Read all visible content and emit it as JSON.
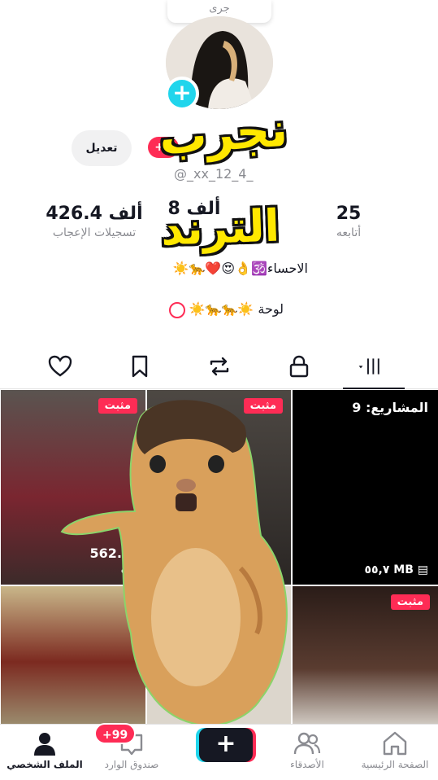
{
  "profile": {
    "display_name": "جرى",
    "handle": "@_xx_12_4_",
    "edit_label": "تعديل",
    "notif_count": "+9",
    "bio_line1": "الاحساء🕉️👌😍❤️🐆☀️",
    "bio_line2": "لوحة ☀️🐆🐆☀️"
  },
  "stats": {
    "likes_value": "426.4 ألف",
    "likes_label": "تسجيلات الإعجاب",
    "followers_value": "8 ألف",
    "following_value": "25",
    "following_label": "أتابعه"
  },
  "sticker": {
    "line1": "نجرب",
    "line2": "الترند"
  },
  "videos": {
    "pinned_label": "مثبت",
    "views_1": "562.6 ألف",
    "drafts_label": "المشاريع: 9",
    "drafts_size": "٥٥,٧ MB"
  },
  "nav": {
    "home": "الصفحة الرئيسية",
    "friends": "الأصدقاء",
    "inbox": "صندوق الوارد",
    "profile": "الملف الشخصي",
    "inbox_badge": "+99",
    "create": "+"
  },
  "colors": {
    "accent_red": "#fe2c55",
    "accent_cyan": "#20d5ec",
    "text": "#161823",
    "muted": "#8a8b91"
  }
}
